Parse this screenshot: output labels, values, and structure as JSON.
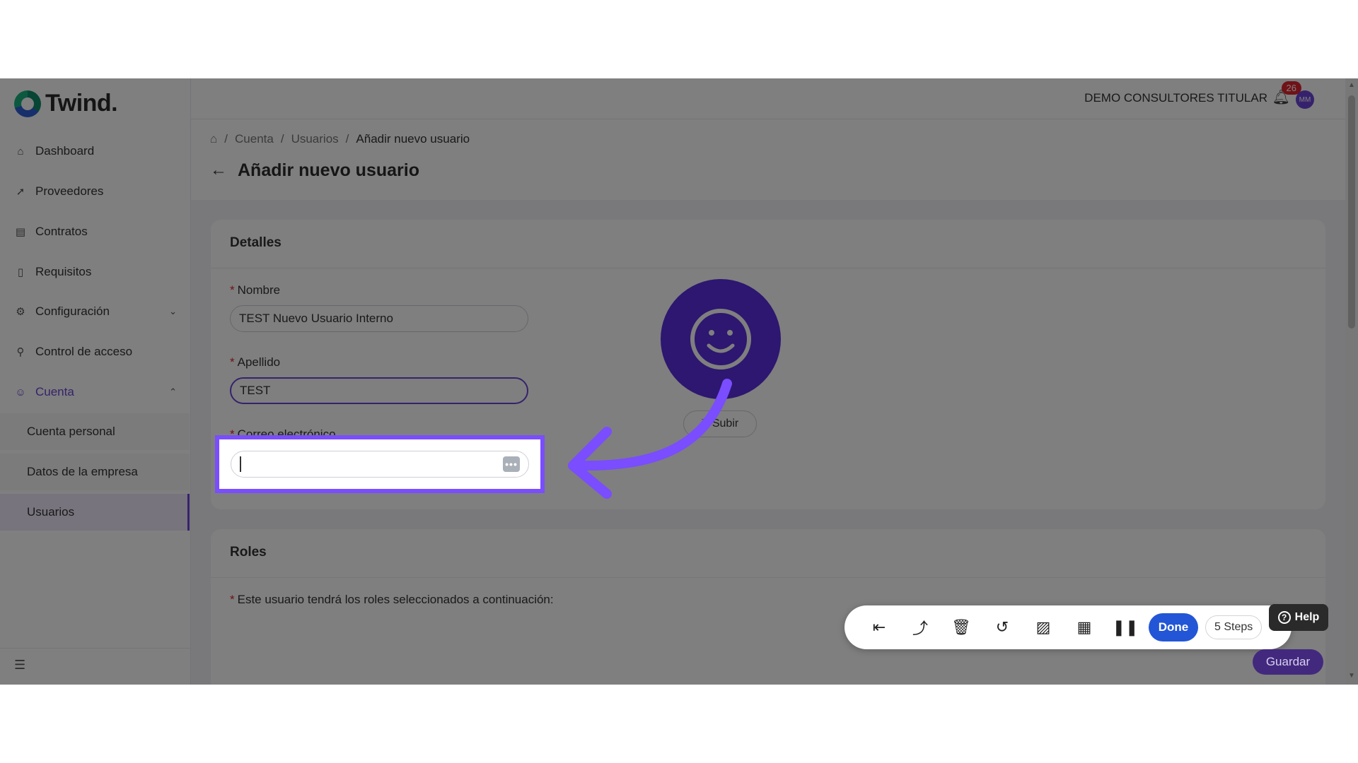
{
  "brand": {
    "name": "Twind."
  },
  "sidebar": {
    "items": [
      {
        "label": "Dashboard",
        "icon": "home-icon"
      },
      {
        "label": "Proveedores",
        "icon": "rocket-icon"
      },
      {
        "label": "Contratos",
        "icon": "contract-icon"
      },
      {
        "label": "Requisitos",
        "icon": "file-icon"
      },
      {
        "label": "Configuración",
        "icon": "gear-icon"
      },
      {
        "label": "Control de acceso",
        "icon": "key-icon"
      },
      {
        "label": "Cuenta",
        "icon": "smile-icon"
      }
    ],
    "subitems": [
      {
        "label": "Cuenta personal"
      },
      {
        "label": "Datos de la empresa"
      },
      {
        "label": "Usuarios"
      }
    ]
  },
  "topbar": {
    "company": "DEMO CONSULTORES TITULAR",
    "notifications": "26",
    "avatar_initials": "MM"
  },
  "breadcrumb": {
    "items": [
      "Cuenta",
      "Usuarios"
    ],
    "current": "Añadir nuevo usuario"
  },
  "page": {
    "title": "Añadir nuevo usuario"
  },
  "details": {
    "title": "Detalles",
    "nombre_label": "Nombre",
    "nombre_value": "TEST Nuevo Usuario Interno",
    "apellido_label": "Apellido",
    "apellido_value": "TEST",
    "email_label": "Correo electrónico",
    "email_value": "",
    "upload_label": "Subir"
  },
  "roles": {
    "title": "Roles",
    "description": "Este usuario tendrá los roles seleccionados a continuación:"
  },
  "recorder": {
    "done_label": "Done",
    "steps_label": "5 Steps"
  },
  "help": {
    "label": "Help"
  },
  "actions": {
    "save_label": "Guardar"
  },
  "colors": {
    "accent": "#6c44d8",
    "highlight": "#7a4dff",
    "done": "#2356d6",
    "badge": "#e0242f"
  }
}
